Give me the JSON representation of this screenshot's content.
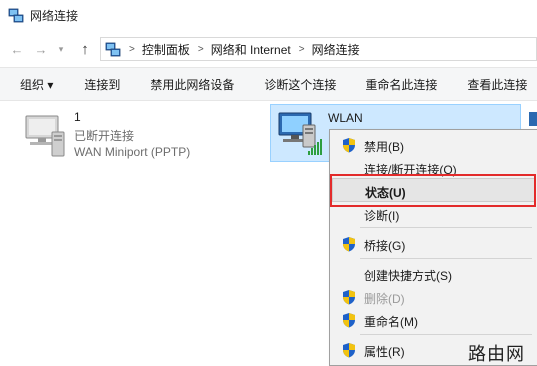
{
  "window": {
    "title": "网络连接"
  },
  "address": {
    "crumbs": [
      "控制面板",
      "网络和 Internet",
      "网络连接"
    ]
  },
  "toolbar": {
    "organize": "组织 ▾",
    "connect_to": "连接到",
    "disable_device": "禁用此网络设备",
    "diagnose": "诊断这个连接",
    "rename": "重命名此连接",
    "view_status": "查看此连接"
  },
  "connections": [
    {
      "name": "1",
      "status": "已断开连接",
      "device": "WAN Miniport (PPTP)"
    },
    {
      "name": "WLAN"
    }
  ],
  "context_menu": {
    "items": [
      {
        "label": "禁用(B)",
        "icon": "shield-icon",
        "enabled": true
      },
      {
        "label": "连接/断开连接(O)",
        "enabled": true
      },
      {
        "label": "状态(U)",
        "enabled": true,
        "highlighted": true
      },
      {
        "label": "诊断(I)",
        "enabled": true
      },
      {
        "label": "桥接(G)",
        "icon": "shield-icon",
        "enabled": true
      },
      {
        "label": "创建快捷方式(S)",
        "enabled": true
      },
      {
        "label": "删除(D)",
        "icon": "shield-icon",
        "enabled": false
      },
      {
        "label": "重命名(M)",
        "icon": "shield-icon",
        "enabled": true
      },
      {
        "label": "属性(R)",
        "icon": "shield-icon",
        "enabled": true
      }
    ]
  },
  "watermark": "路由网",
  "colors": {
    "selection_bg": "#cde8ff",
    "selection_border": "#99d1ff",
    "highlight_box": "#e32b2b",
    "menu_bg": "#f2f2f2",
    "signal_green": "#2e9e3f"
  }
}
